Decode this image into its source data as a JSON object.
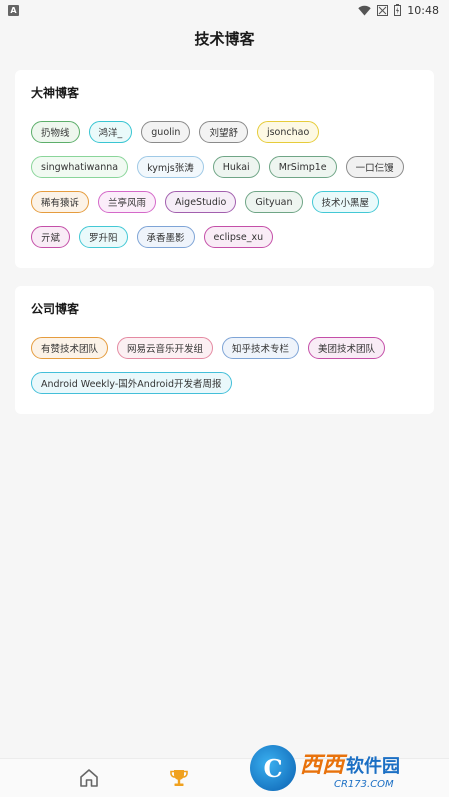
{
  "status_bar": {
    "notif_letter": "A",
    "time": "10:48"
  },
  "header": {
    "title": "技术博客"
  },
  "dashen": {
    "title": "大神博客",
    "rows": [
      [
        {
          "label": "扔物线",
          "color": "#5cae6a",
          "bg": "#eef7ee"
        },
        {
          "label": "鸿洋_",
          "color": "#39c5d2",
          "bg": "#eafafa"
        },
        {
          "label": "guolin",
          "color": "#8a8a8a",
          "bg": "#f3f3f3"
        },
        {
          "label": "刘望舒",
          "color": "#8a8a8a",
          "bg": "#f3f3f3"
        },
        {
          "label": "jsonchao",
          "color": "#e6cc3a",
          "bg": "#fdf9e4"
        }
      ],
      [
        {
          "label": "singwhatiwanna",
          "color": "#8ad59a",
          "bg": "#f1faf2"
        },
        {
          "label": "kymjs张涛",
          "color": "#9fc9e6",
          "bg": "#f2f8fc"
        },
        {
          "label": "Hukai",
          "color": "#6fa586",
          "bg": "#eef5f0"
        },
        {
          "label": "MrSimp1e",
          "color": "#6fa586",
          "bg": "#eef5f0"
        },
        {
          "label": "一口仨馒",
          "color": "#8a8a8a",
          "bg": "#f1f1f1"
        }
      ],
      [
        {
          "label": "稀有猿诉",
          "color": "#e59c3e",
          "bg": "#fcf3e8"
        },
        {
          "label": "兰亭风雨",
          "color": "#d469c9",
          "bg": "#fbeefa"
        },
        {
          "label": "AigeStudio",
          "color": "#a25fae",
          "bg": "#f6eef8"
        },
        {
          "label": "Gityuan",
          "color": "#6fa586",
          "bg": "#eef5f0"
        },
        {
          "label": "技术小黑屋",
          "color": "#43c8d5",
          "bg": "#eafafb"
        }
      ],
      [
        {
          "label": "亓斌",
          "color": "#c44fa8",
          "bg": "#f9ecf6"
        },
        {
          "label": "罗升阳",
          "color": "#43c8d5",
          "bg": "#eafafb"
        },
        {
          "label": "承香墨影",
          "color": "#7ea4d6",
          "bg": "#eff4fb"
        },
        {
          "label": "eclipse_xu",
          "color": "#c44fa8",
          "bg": "#f9ecf6"
        }
      ]
    ]
  },
  "company": {
    "title": "公司博客",
    "rows": [
      [
        {
          "label": "有赞技术团队",
          "color": "#e59c3e",
          "bg": "#fcf3e8"
        },
        {
          "label": "网易云音乐开发组",
          "color": "#e48aa2",
          "bg": "#fcf0f3"
        },
        {
          "label": "知乎技术专栏",
          "color": "#7ea4d6",
          "bg": "#eff4fb"
        },
        {
          "label": "美团技术团队",
          "color": "#c44fa8",
          "bg": "#f9ecf6"
        }
      ],
      [
        {
          "label": "Android Weekly-国外Android开发者周报",
          "color": "#43bfd9",
          "bg": "#eaf8fb"
        }
      ]
    ]
  },
  "bottom_nav": {
    "items": [
      {
        "icon": "home-icon"
      },
      {
        "icon": "trophy-icon",
        "active_color": "#f0a11e"
      }
    ]
  },
  "watermark": {
    "logo_letter": "C",
    "brand_orange": "西西",
    "brand_blue": "软件园",
    "url": "CR173.COM"
  }
}
